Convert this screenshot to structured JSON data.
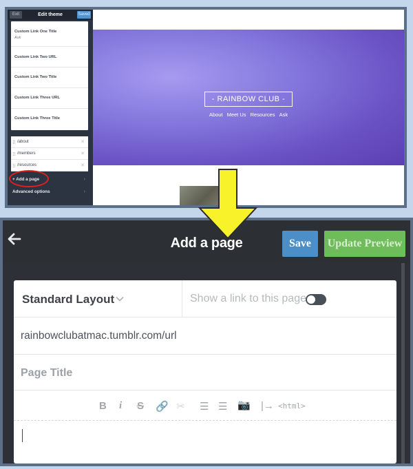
{
  "top": {
    "editor": {
      "exit_label": "Exit",
      "title": "Edit theme",
      "saved_label": "Saved",
      "fields": [
        {
          "label": "Custom Link One Title",
          "value": "Ask"
        },
        {
          "label": "Custom Link Two URL",
          "value": ""
        },
        {
          "label": "Custom Link Two Title",
          "value": ""
        },
        {
          "label": "Custom Link Three URL",
          "value": ""
        },
        {
          "label": "Custom Link Three Title",
          "value": ""
        }
      ],
      "pages": [
        "/about",
        "/members",
        "/resources"
      ],
      "add_page_label": "+ Add a page",
      "advanced_label": "Advanced options"
    },
    "preview": {
      "logo": "- RAINBOW CLUB -",
      "nav": [
        "About",
        "Meet Us",
        "Resources",
        "Ask"
      ]
    }
  },
  "bottom": {
    "title": "Add a page",
    "save_label": "Save",
    "update_label": "Update Preview",
    "layout_label": "Standard Layout",
    "show_link_label": "Show a link to this page",
    "url": "rainbowclubatmac.tumblr.com/url",
    "page_title_placeholder": "Page Title",
    "toolbar": {
      "bold": "B",
      "italic": "i",
      "strike": "S",
      "link": "🔗",
      "unlink": "✂",
      "ol": "☰",
      "ul": "☰",
      "camera": "📷",
      "readmore": "|→",
      "html": "<html>"
    }
  },
  "colors": {
    "accent_blue": "#4b8ec8",
    "accent_green": "#6fbc5a",
    "arrow_yellow": "#f7f22a",
    "annotation_red": "#e02020"
  },
  "icons": [
    "back-arrow-icon",
    "chevron-down-icon",
    "close-icon",
    "drag-handle-icon",
    "chevron-right-icon",
    "toggle-icon",
    "camera-icon",
    "link-icon",
    "unlink-icon"
  ]
}
